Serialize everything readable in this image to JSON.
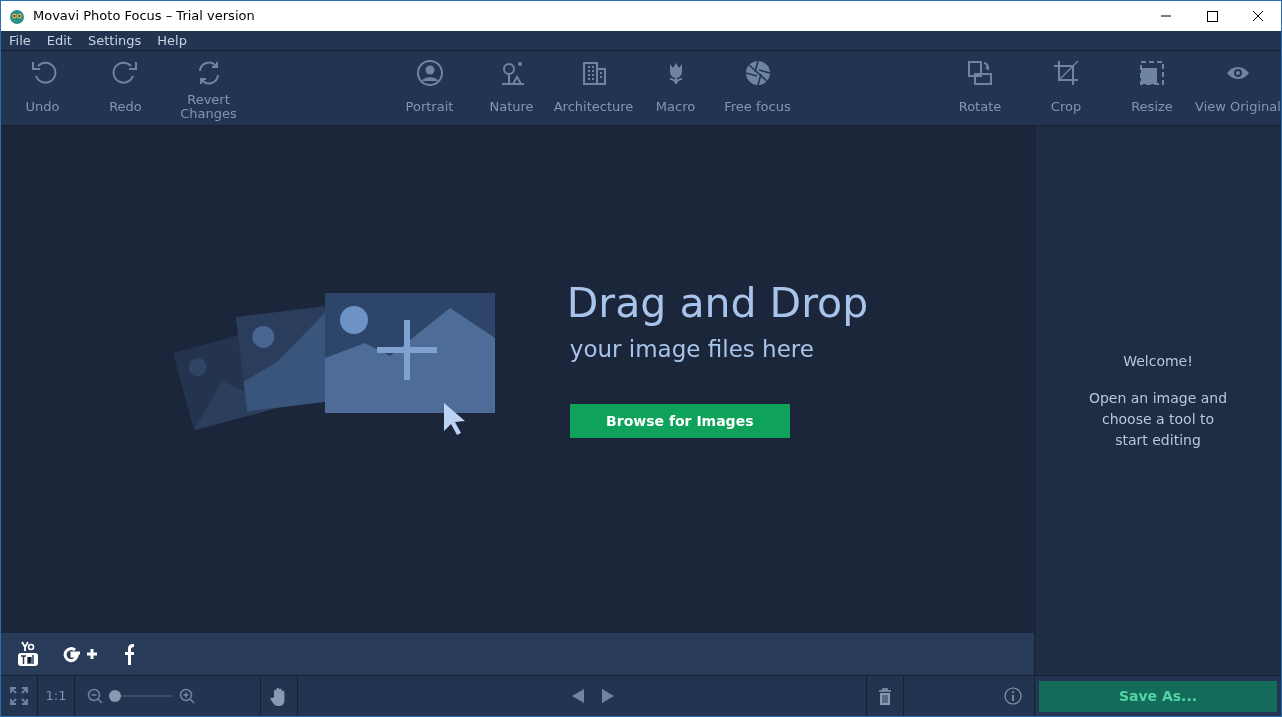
{
  "window": {
    "title": "Movavi Photo Focus – Trial version"
  },
  "menu": [
    "File",
    "Edit",
    "Settings",
    "Help"
  ],
  "history_tools": [
    "Undo",
    "Redo",
    "Revert Changes"
  ],
  "focus_tools": [
    "Portrait",
    "Nature",
    "Architecture",
    "Macro",
    "Free focus"
  ],
  "edit_tools": [
    "Rotate",
    "Crop",
    "Resize",
    "View Original"
  ],
  "drop_area": {
    "heading": "Drag and Drop",
    "subheading": "your image files here",
    "button": "Browse for Images"
  },
  "side_panel": {
    "welcome": "Welcome!",
    "hint": "Open an image and choose a tool to start editing"
  },
  "bottom_bar": {
    "actual_size": "1:1",
    "zoom": {
      "level": 0
    },
    "save_button": "Save As..."
  }
}
